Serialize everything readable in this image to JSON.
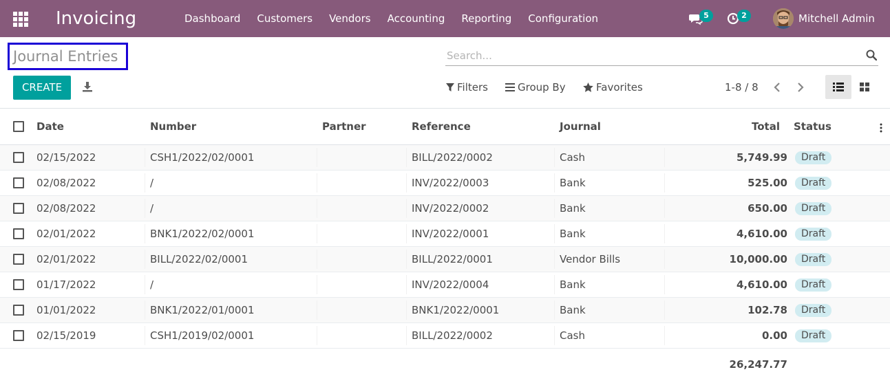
{
  "navbar": {
    "app_title": "Invoicing",
    "menu": [
      "Dashboard",
      "Customers",
      "Vendors",
      "Accounting",
      "Reporting",
      "Configuration"
    ],
    "messages_count": "5",
    "activities_count": "2",
    "user_name": "Mitchell Admin"
  },
  "control_panel": {
    "breadcrumb": "Journal Entries",
    "search_placeholder": "Search...",
    "create_label": "CREATE",
    "filters_label": "Filters",
    "group_by_label": "Group By",
    "favorites_label": "Favorites",
    "pager": "1-8 / 8"
  },
  "table": {
    "columns": {
      "date": "Date",
      "number": "Number",
      "partner": "Partner",
      "reference": "Reference",
      "journal": "Journal",
      "total": "Total",
      "status": "Status"
    },
    "rows": [
      {
        "date": "02/15/2022",
        "number": "CSH1/2022/02/0001",
        "partner": "",
        "reference": "BILL/2022/0002",
        "journal": "Cash",
        "total": "5,749.99",
        "status": "Draft"
      },
      {
        "date": "02/08/2022",
        "number": "/",
        "partner": "",
        "reference": "INV/2022/0003",
        "journal": "Bank",
        "total": "525.00",
        "status": "Draft"
      },
      {
        "date": "02/08/2022",
        "number": "/",
        "partner": "",
        "reference": "INV/2022/0002",
        "journal": "Bank",
        "total": "650.00",
        "status": "Draft"
      },
      {
        "date": "02/01/2022",
        "number": "BNK1/2022/02/0001",
        "partner": "",
        "reference": "INV/2022/0001",
        "journal": "Bank",
        "total": "4,610.00",
        "status": "Draft"
      },
      {
        "date": "02/01/2022",
        "number": "BILL/2022/02/0001",
        "partner": "",
        "reference": "BILL/2022/0001",
        "journal": "Vendor Bills",
        "total": "10,000.00",
        "status": "Draft"
      },
      {
        "date": "01/17/2022",
        "number": "/",
        "partner": "",
        "reference": "INV/2022/0004",
        "journal": "Bank",
        "total": "4,610.00",
        "status": "Draft"
      },
      {
        "date": "01/01/2022",
        "number": "BNK1/2022/01/0001",
        "partner": "",
        "reference": "BNK1/2022/0001",
        "journal": "Bank",
        "total": "102.78",
        "status": "Draft"
      },
      {
        "date": "02/15/2019",
        "number": "CSH1/2019/02/0001",
        "partner": "",
        "reference": "BILL/2022/0002",
        "journal": "Cash",
        "total": "0.00",
        "status": "Draft"
      }
    ],
    "sum_total": "26,247.77"
  },
  "colors": {
    "navbar": "#875a7b",
    "primary": "#00a09d",
    "status_badge": "#d1ecf1",
    "highlight_border": "#1a00d6"
  }
}
